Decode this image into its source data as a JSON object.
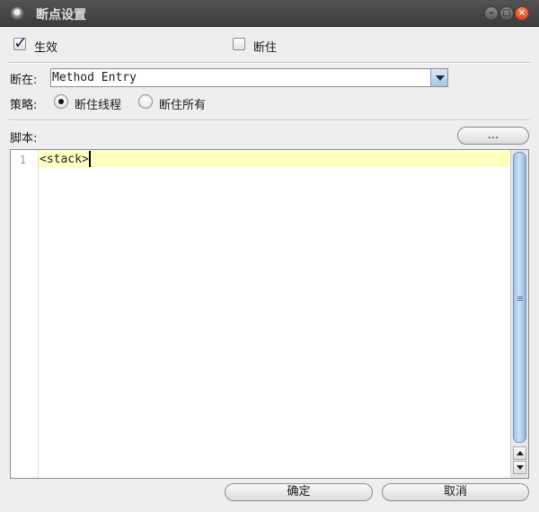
{
  "window": {
    "title": "断点设置",
    "controls": [
      "minimize-icon",
      "maximize-icon",
      "close-icon"
    ]
  },
  "options": {
    "enabled_label": "生效",
    "enabled_checked": true,
    "suspend_label": "断住",
    "suspend_checked": false
  },
  "break_at": {
    "label": "断在:",
    "value": "Method Entry"
  },
  "policy": {
    "label": "策略:",
    "options": [
      {
        "label": "断住线程",
        "selected": true
      },
      {
        "label": "断住所有",
        "selected": false
      }
    ]
  },
  "script": {
    "label": "脚本:",
    "browse_label": "...",
    "lines": [
      {
        "number": "1",
        "text": "<stack>"
      }
    ]
  },
  "footer": {
    "ok_label": "确定",
    "cancel_label": "取消"
  },
  "colors": {
    "titlebar": "#444444",
    "current_line": "#ffffc0",
    "scroll_thumb": "#9ec0e6",
    "close_button": "#e05a2a"
  }
}
